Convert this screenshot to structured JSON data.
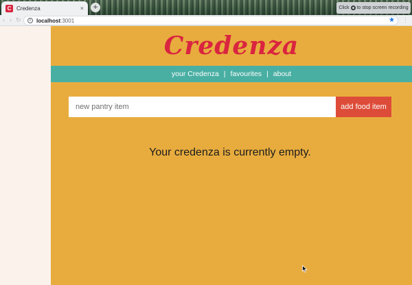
{
  "browser": {
    "tab_title": "Credenza",
    "favicon_letter": "C",
    "new_tab_symbol": "+",
    "close_symbol": "×",
    "recording_left": "Click",
    "recording_right": "to stop screen recording",
    "url_host": "localhost",
    "url_port": ":3001"
  },
  "app": {
    "logo": "Credenza",
    "nav": {
      "your_credenza": "your Credenza",
      "favourites": "favourites",
      "about": "about",
      "separator": "|"
    },
    "form": {
      "placeholder": "new pantry item",
      "value": "",
      "button_label": "add food item"
    },
    "empty_message": "Your credenza is currently empty."
  },
  "colors": {
    "page_background": "#e8ac3e",
    "logo": "#d9253f",
    "navbar": "#4aafa3",
    "button": "#dd4c38",
    "sidebar": "#fbf2ec"
  },
  "icons": [
    "favicon-icon",
    "tab-close-icon",
    "new-tab-icon",
    "record-icon",
    "info-icon",
    "bookmark-star-icon",
    "mouse-cursor-icon"
  ]
}
